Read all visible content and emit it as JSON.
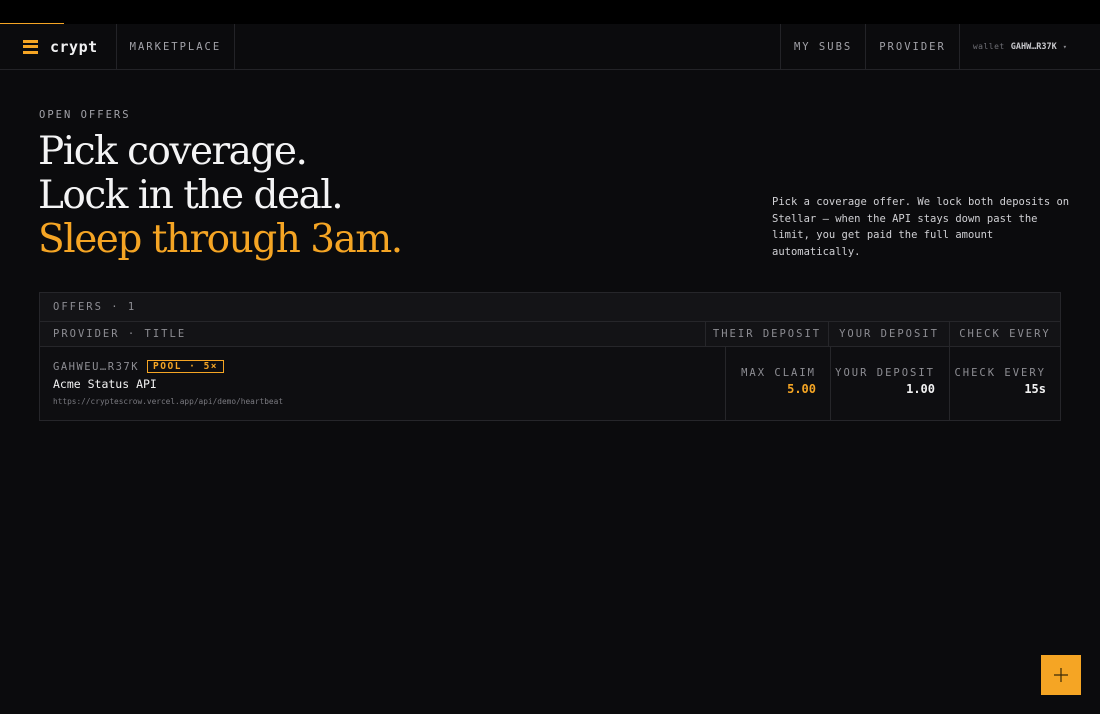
{
  "nav": {
    "brand": "crypt",
    "marketplace": "MARKETPLACE",
    "my_subs": "MY SUBS",
    "provider": "PROVIDER",
    "wallet_label": "wallet",
    "wallet_address": "GAHW…R37K",
    "wallet_caret": "▾"
  },
  "hero": {
    "eyebrow": "OPEN OFFERS",
    "line1": "Pick coverage.",
    "line2": "Lock in the deal.",
    "line3": "Sleep through 3am.",
    "intro": "Pick a coverage offer. We lock both deposits on Stellar — when the API stays down past the limit, you get paid the full amount automatically."
  },
  "offers": {
    "title": "OFFERS · 1",
    "headers": {
      "provider_title": "PROVIDER · TITLE",
      "their_deposit": "THEIR DEPOSIT",
      "your_deposit": "YOUR DEPOSIT",
      "check_every": "CHECK EVERY"
    },
    "rows": [
      {
        "provider": "GAHWEU…R37K",
        "badge": "POOL · 5×",
        "title": "Acme Status API",
        "url": "https://cryptescrow.vercel.app/api/demo/heartbeat",
        "max_claim_label": "MAX CLAIM",
        "max_claim": "5.00",
        "your_deposit_label": "YOUR DEPOSIT",
        "your_deposit": "1.00",
        "check_every_label": "CHECK EVERY",
        "check_every": "15s"
      }
    ]
  },
  "colors": {
    "accent": "#f5a524",
    "background": "#0b0b0d"
  },
  "icons": {
    "brand": "stacked-bars-logo-icon",
    "fab": "plus-icon"
  }
}
